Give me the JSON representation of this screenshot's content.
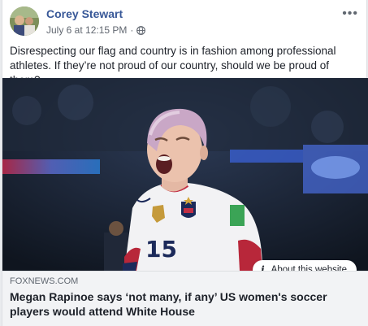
{
  "post": {
    "author": "Corey Stewart",
    "timestamp": "July 6 at 12:15 PM",
    "separator": "·",
    "privacy_icon": "globe-icon",
    "more_options": "•••",
    "text": "Disrespecting our flag and country is in fashion among professional athletes. If they’re not proud of our country, should we be proud of them?"
  },
  "link_preview": {
    "image_alt": "Soccer player in white jersey number 15 shouting in a stadium",
    "jersey_number": "15",
    "about_label": "About this website",
    "about_icon": "info-icon",
    "domain": "FOXNEWS.COM",
    "headline": "Megan Rapinoe says ‘not many, if any’ US women's soccer players would attend White House"
  },
  "colors": {
    "author_link": "#385898",
    "body_text": "#1d2129",
    "meta_text": "#616770",
    "link_bg": "#f2f3f5"
  }
}
